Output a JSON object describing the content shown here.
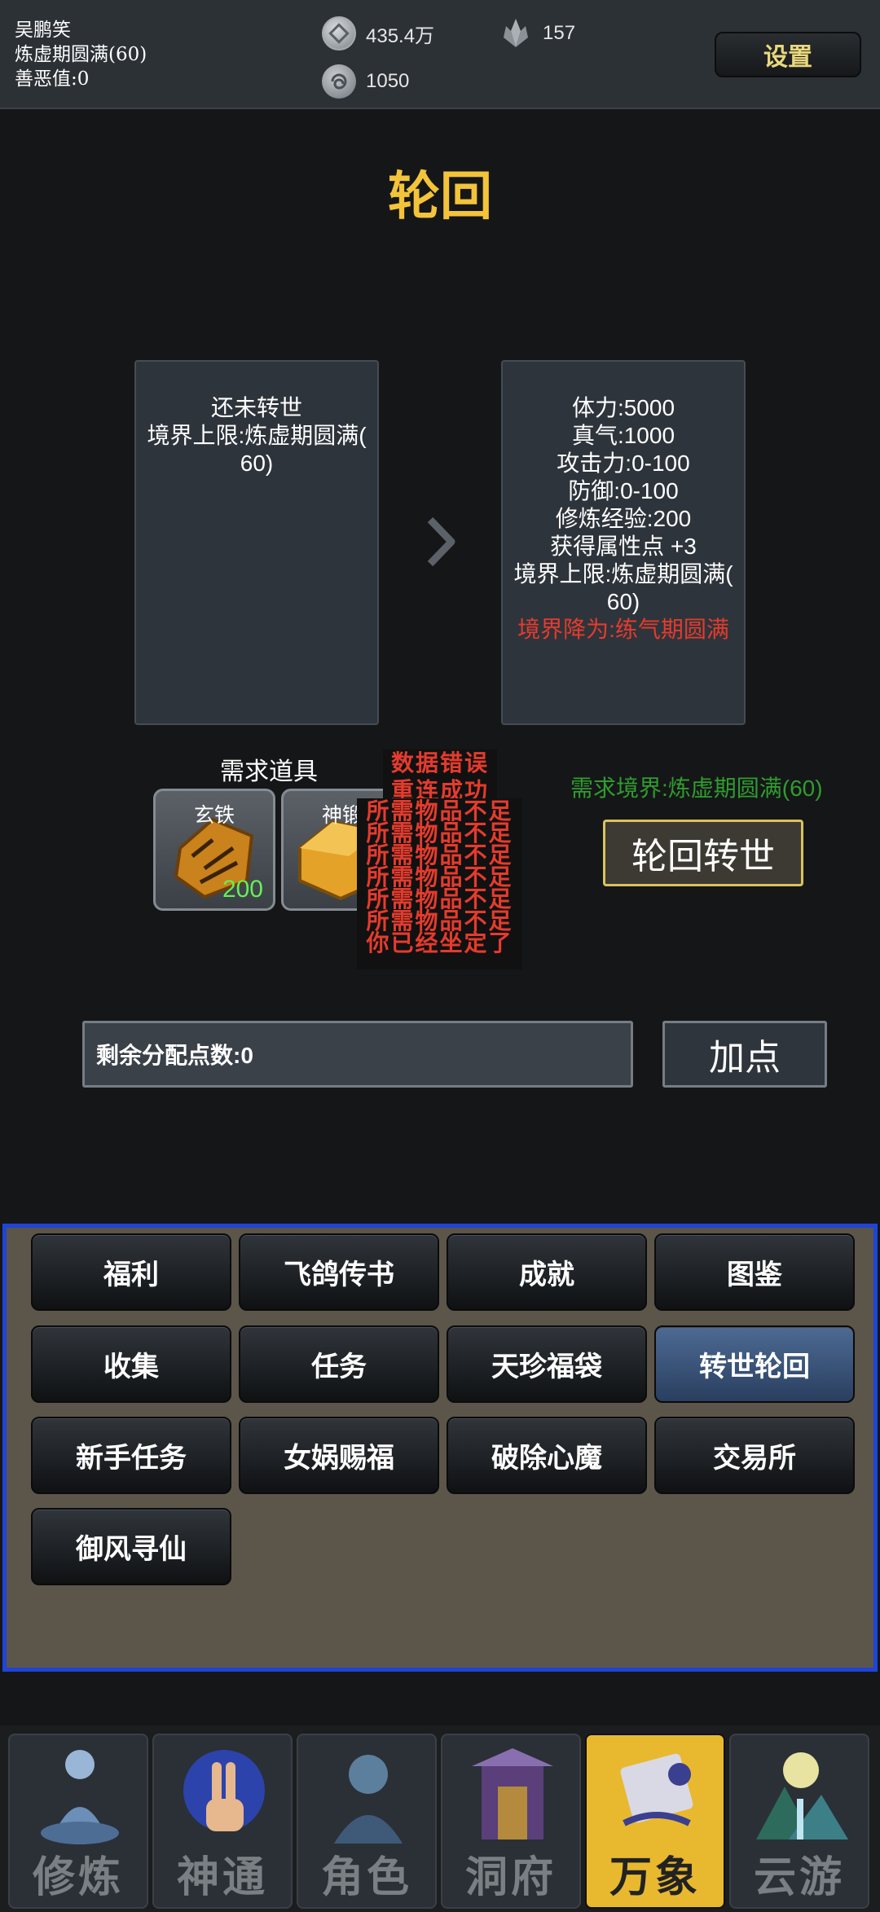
{
  "header": {
    "player_name": "吴鹏笑",
    "realm": "炼虚期圆满(60)",
    "karma": "善恶值:0",
    "coins": "435.4万",
    "crystals": "157",
    "spiral": "1050",
    "settings_label": "设置"
  },
  "title": "轮回",
  "current_panel": {
    "line1": "还未转世",
    "line2": "境界上限:炼虚期圆满(",
    "line3": "60)"
  },
  "next_panel": {
    "lines": [
      "体力:5000",
      "真气:1000",
      "攻击力:0-100",
      "防御:0-100",
      "修炼经验:200",
      "获得属性点 +3",
      "境界上限:炼虚期圆满(",
      "60)"
    ],
    "warning": "境界降为:练气期圆满"
  },
  "required_items": {
    "label": "需求道具",
    "items": [
      {
        "name": "玄铁",
        "qty": "200"
      },
      {
        "name": "神锻"
      }
    ]
  },
  "error_overlay": {
    "line1": "数据错误",
    "line2": "重连成功",
    "lines": [
      "所需物品不足",
      "所需物品不足",
      "所需物品不足",
      "所需物品不足",
      "所需物品不足",
      "所需物品不足",
      "你已经坐定了"
    ]
  },
  "required_realm": "需求境界:炼虚期圆满(60)",
  "reincarnate_label": "轮回转世",
  "points": {
    "text": "剩余分配点数:0",
    "add_label": "加点"
  },
  "menu": {
    "buttons": [
      "福利",
      "飞鸽传书",
      "成就",
      "图鉴",
      "收集",
      "任务",
      "天珍福袋",
      "转世轮回",
      "新手任务",
      "女娲赐福",
      "破除心魔",
      "交易所",
      "御风寻仙"
    ],
    "active": "转世轮回"
  },
  "nav": {
    "tabs": [
      "修炼",
      "神通",
      "角色",
      "洞府",
      "万象",
      "云游"
    ],
    "active": "万象"
  },
  "colors": {
    "title": "#f3c33a",
    "warning": "#e53b2d",
    "realm_req": "#2f9c2f",
    "menu_border": "#1f44d8",
    "nav_active": "#e8b92f"
  }
}
